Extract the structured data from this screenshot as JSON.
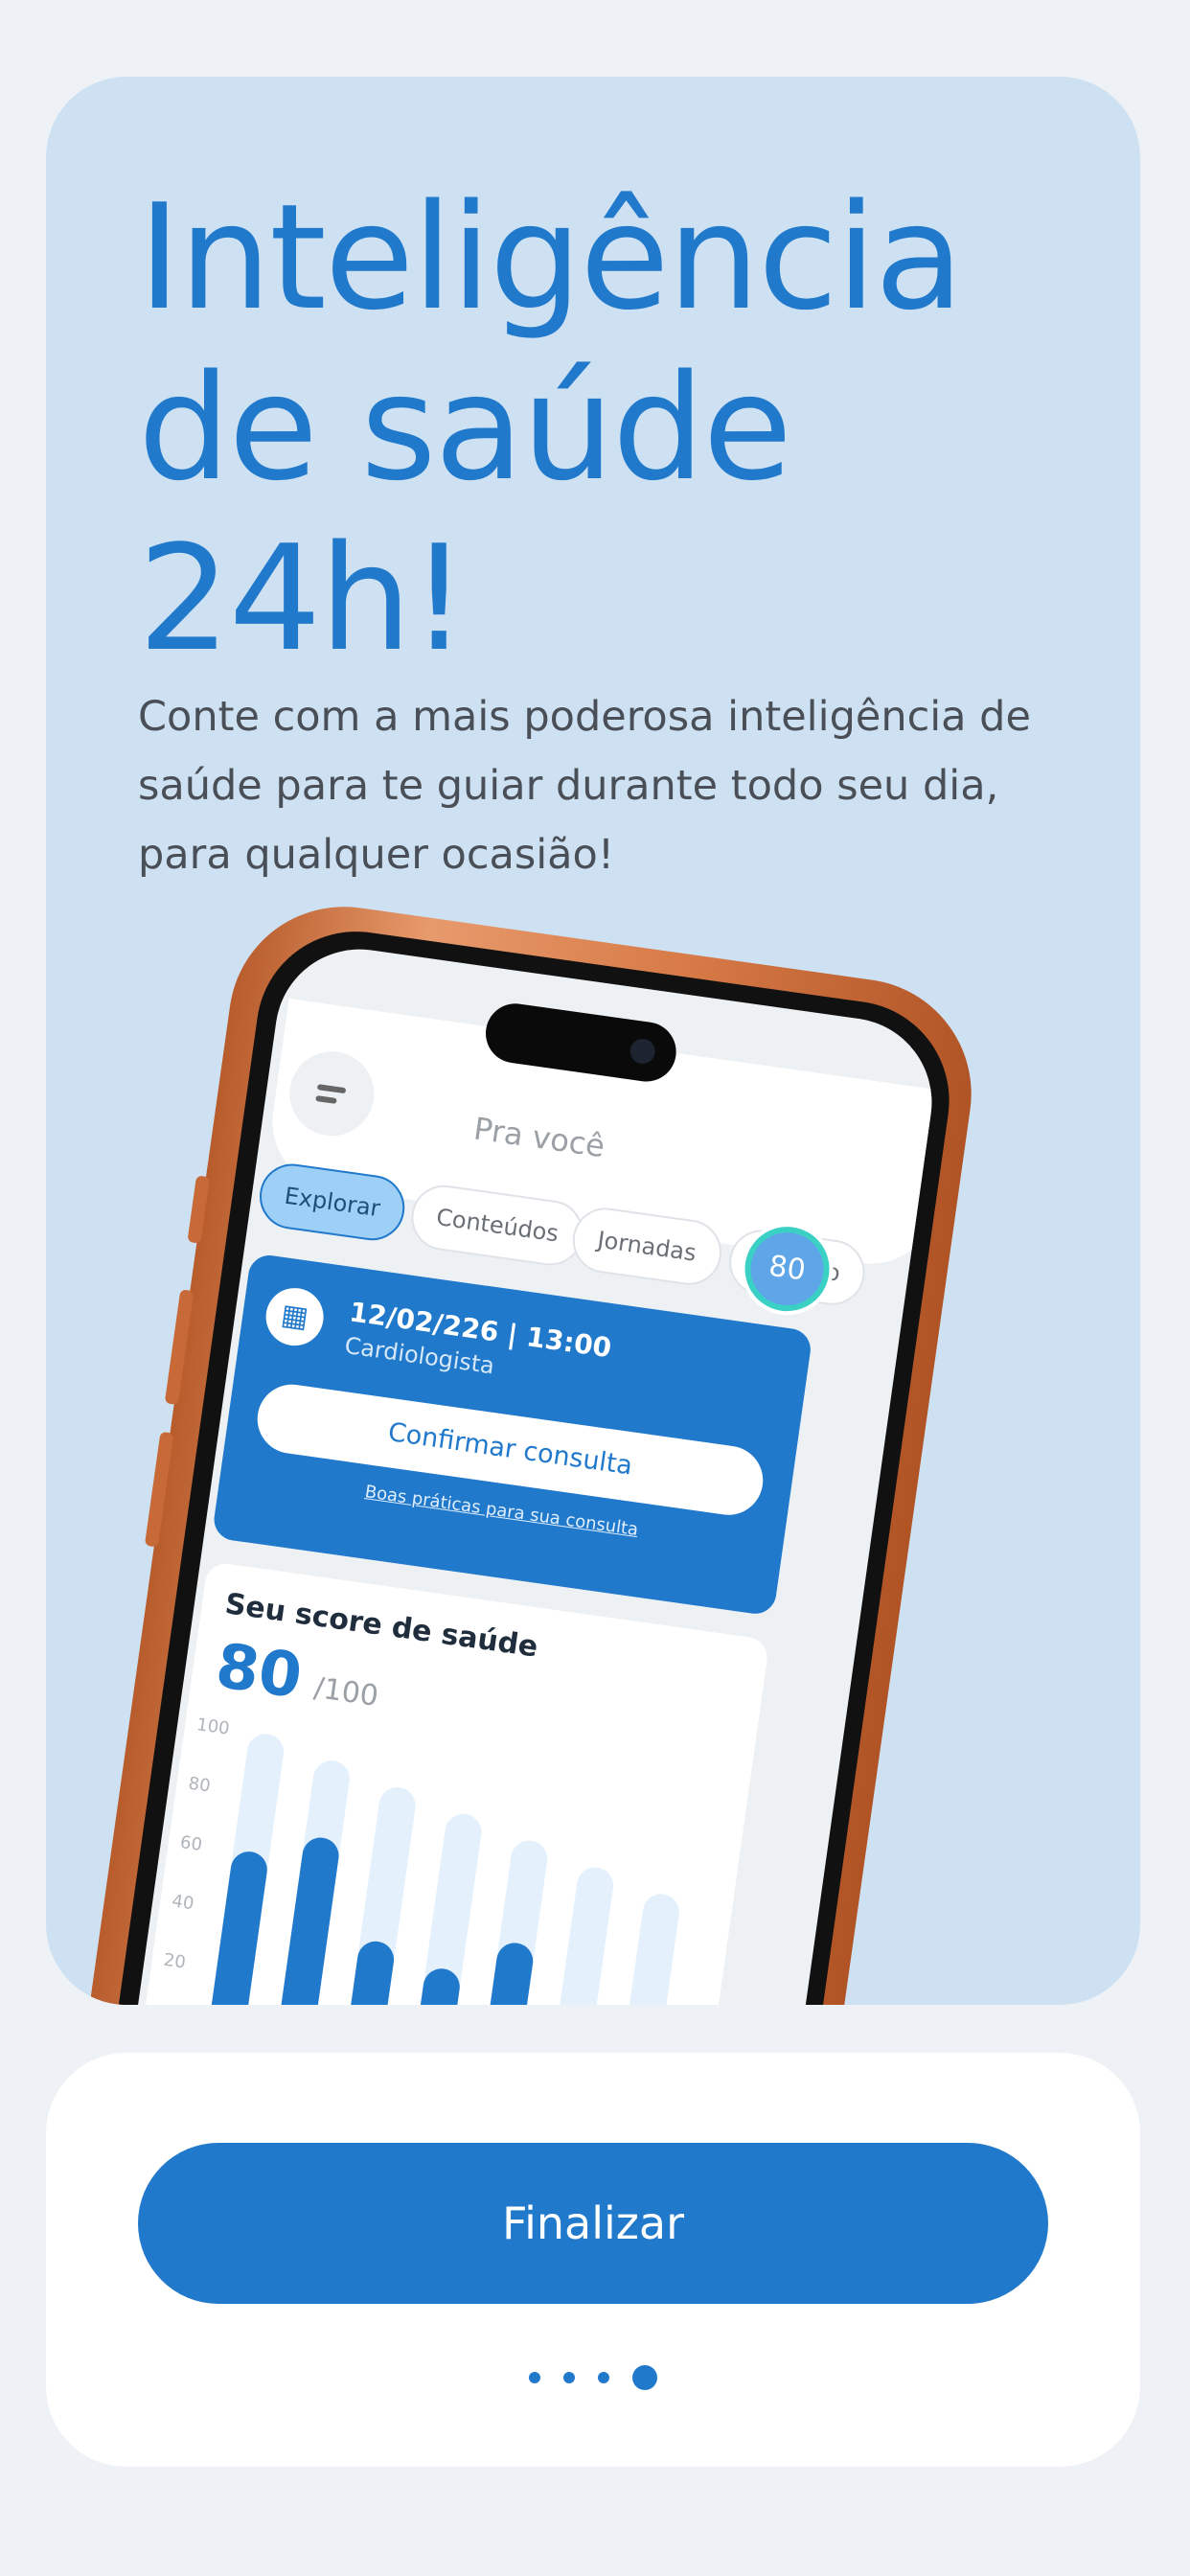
{
  "onboarding": {
    "headline": "Inteligência de saúde 24h!",
    "subtitle": "Conte com a mais poderosa inteligência de saúde para te guiar durante todo seu dia, para qualquer ocasião!",
    "finish_label": "Finalizar",
    "page_indicator": {
      "total": 4,
      "current": 4
    }
  },
  "phone_mockup": {
    "screen_title": "Pra você",
    "chips": [
      "Explorar",
      "Conteúdos",
      "Jornadas",
      "Desafio"
    ],
    "active_chip": "Explorar",
    "score_badge": "80",
    "appointment": {
      "date_time": "12/02/226 | 13:00",
      "specialty": "Cardiologista",
      "confirm_label": "Confirmar consulta",
      "link_label": "Boas práticas para sua consulta"
    },
    "score_card": {
      "title": "Seu score de saúde",
      "value": "80",
      "max": "/100"
    }
  },
  "chart_data": {
    "type": "bar",
    "yticks": [
      "100",
      "80",
      "60",
      "40",
      "20"
    ],
    "ylim": [
      0,
      100
    ],
    "values": [
      60,
      68,
      36,
      30,
      42,
      0,
      0
    ]
  },
  "colors": {
    "accent": "#2179cc",
    "hero_background": "#cde1f2",
    "page_background": "#eef1f5",
    "phone_frame": "#d77a47"
  }
}
